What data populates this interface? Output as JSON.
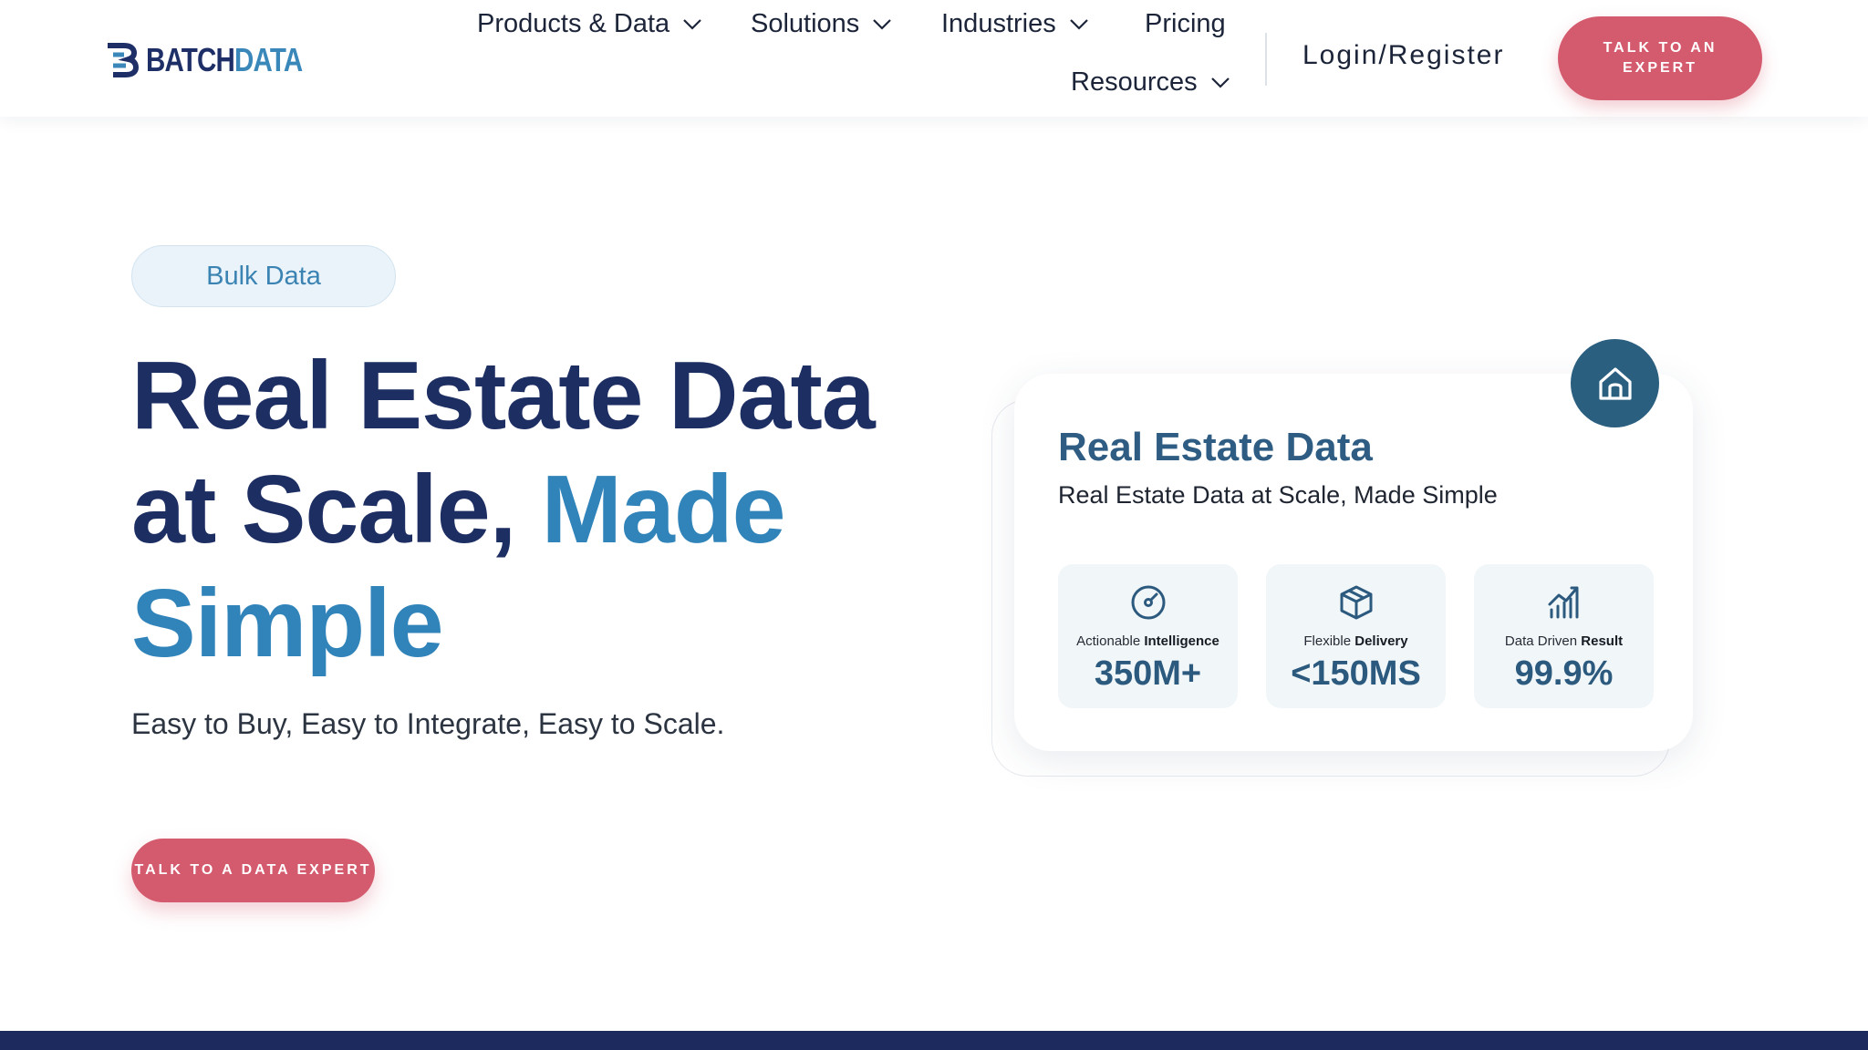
{
  "brand": {
    "logo_part1": "BATCH",
    "logo_part2": "DATA",
    "colors": {
      "navy": "#1d2e63",
      "blue": "#3184ba",
      "cta": "#d45a6e"
    }
  },
  "nav": {
    "products": "Products & Data",
    "solutions": "Solutions",
    "industries": "Industries",
    "pricing": "Pricing",
    "resources": "Resources",
    "login": "Login/Register",
    "cta": "TALK TO AN EXPERT"
  },
  "hero": {
    "pill": "Bulk Data",
    "headline_line1": "Real Estate Data",
    "headline_line2_dark": "at Scale,",
    "headline_line2_accent": "Made",
    "headline_line3_accent": "Simple",
    "subhead": "Easy to Buy, Easy to Integrate, Easy to Scale.",
    "cta": "TALK TO A DATA EXPERT"
  },
  "card": {
    "title": "Real Estate Data",
    "subtitle": "Real Estate Data at Scale, Made Simple",
    "stats": [
      {
        "icon": "gauge-icon",
        "label_plain": "Actionable ",
        "label_bold": "Intelligence",
        "value": "350M+"
      },
      {
        "icon": "box-icon",
        "label_plain": "Flexible ",
        "label_bold": "Delivery",
        "value": "<150MS"
      },
      {
        "icon": "bar-chart-icon",
        "label_plain": "Data Driven ",
        "label_bold": "Result",
        "value": "99.9%"
      }
    ]
  }
}
